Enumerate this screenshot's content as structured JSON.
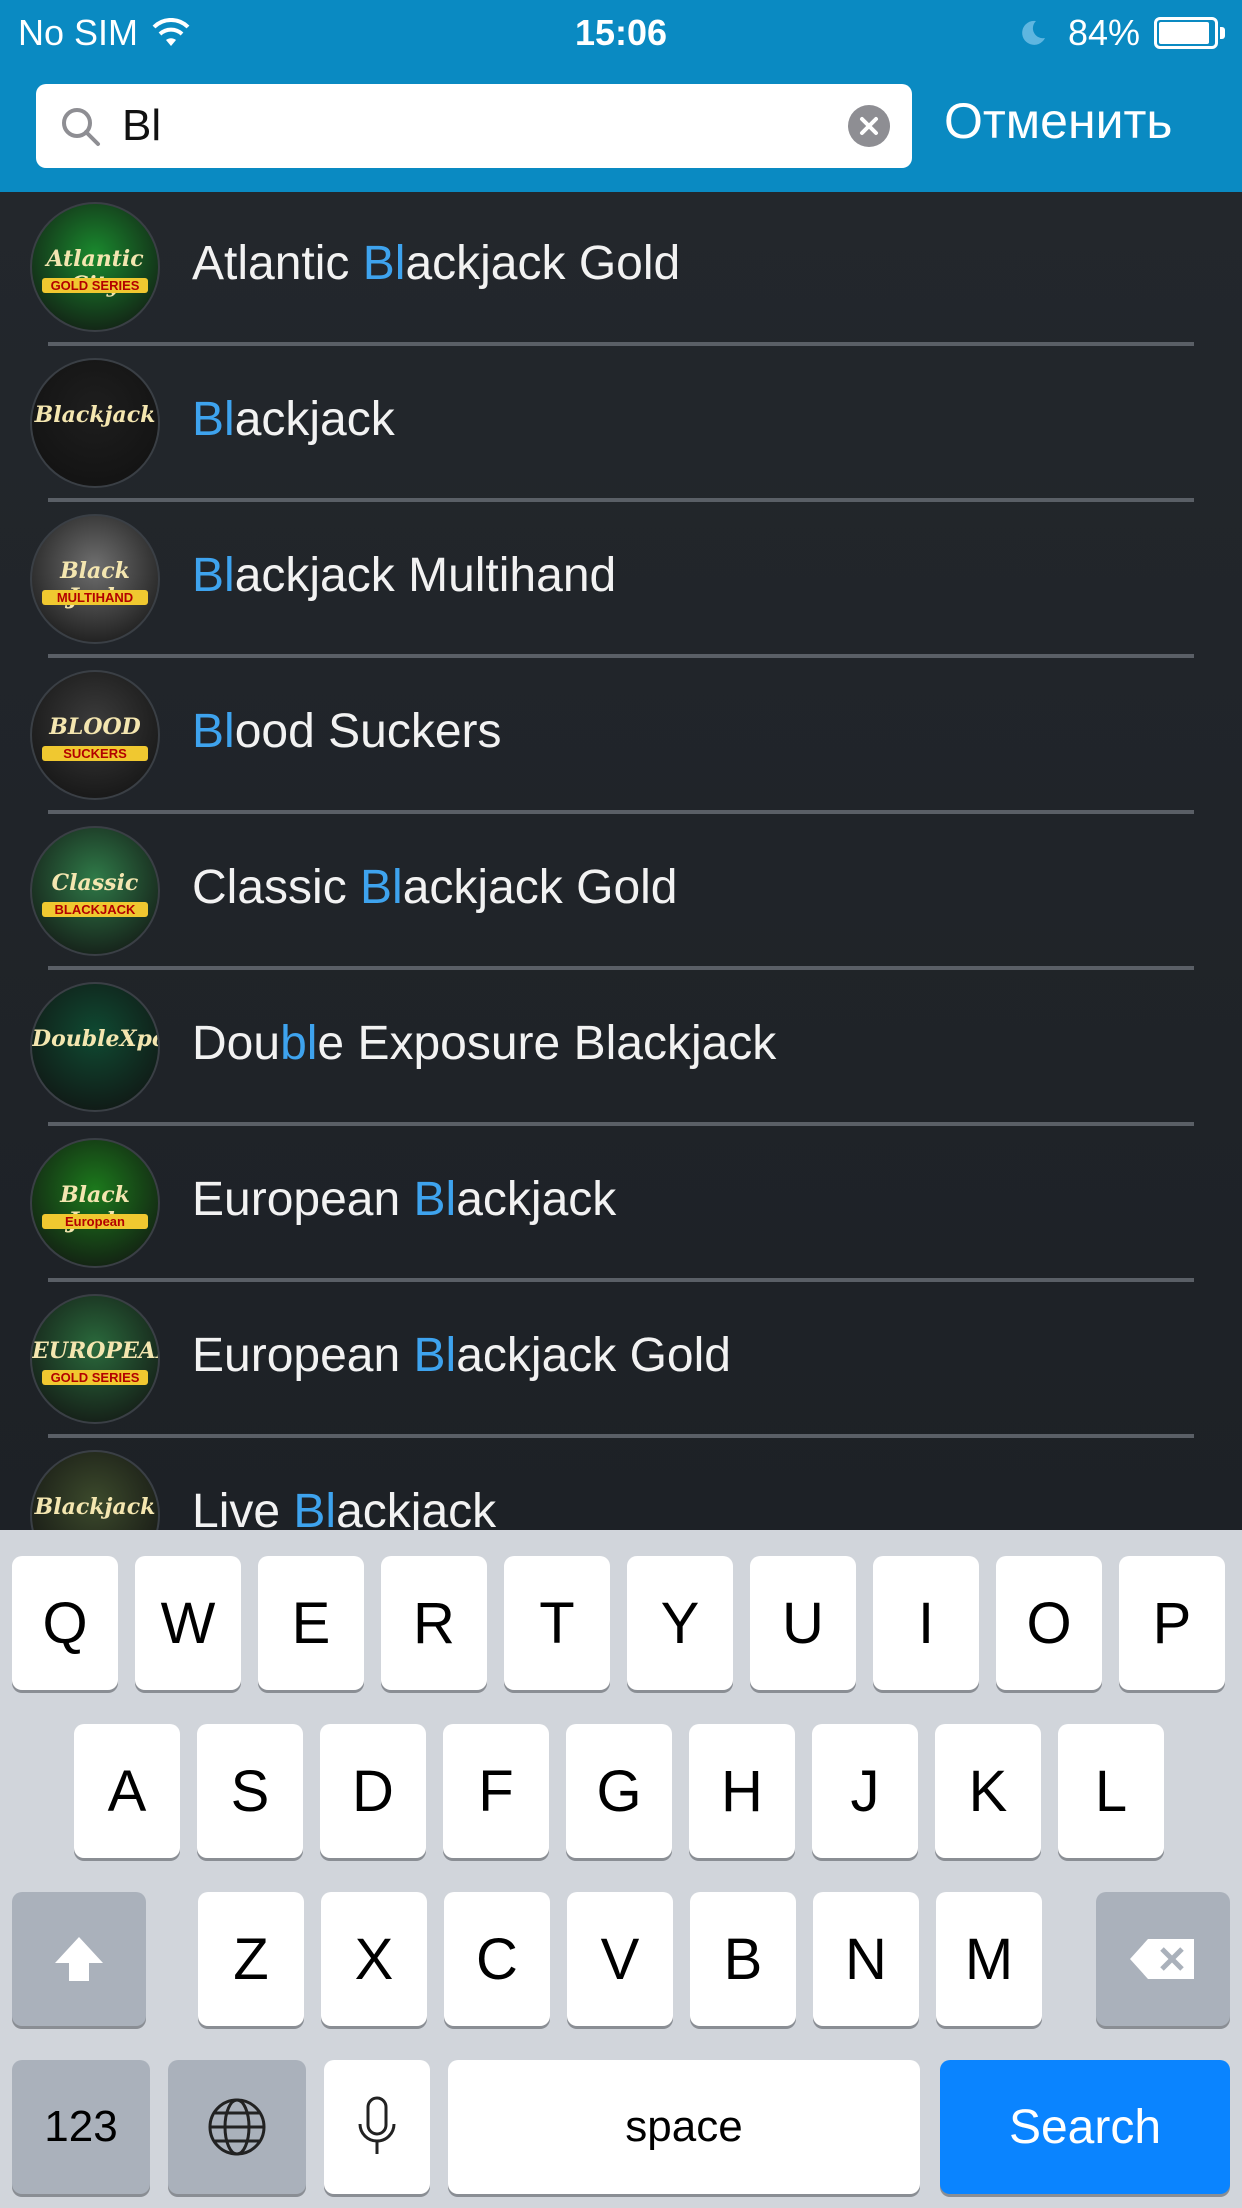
{
  "status_bar": {
    "carrier": "No SIM",
    "time": "15:06",
    "battery": "84%"
  },
  "search": {
    "value": "Bl",
    "cancel_label": "Отменить"
  },
  "results": [
    {
      "pre": "Atlantic ",
      "hl": "Bl",
      "post": "ackjack Gold",
      "thumb": {
        "line1": "Atlantic City",
        "line2": "GOLD SERIES",
        "bg": "#1a8a2e"
      }
    },
    {
      "pre": "",
      "hl": "Bl",
      "post": "ackjack",
      "thumb": {
        "line1": "Blackjack",
        "line2": "",
        "bg": "#1e1e1e"
      }
    },
    {
      "pre": "",
      "hl": "Bl",
      "post": "ackjack Multihand",
      "thumb": {
        "line1": "Black Jack",
        "line2": "MULTIHAND",
        "bg": "#6f6f6f"
      }
    },
    {
      "pre": "",
      "hl": "Bl",
      "post": "ood Suckers",
      "thumb": {
        "line1": "BLOOD",
        "line2": "SUCKERS",
        "bg": "#3b3b3b"
      }
    },
    {
      "pre": "Classic ",
      "hl": "Bl",
      "post": "ackjack Gold",
      "thumb": {
        "line1": "Classic",
        "line2": "BLACKJACK",
        "bg": "#2f7a48"
      }
    },
    {
      "pre": "Dou",
      "hl": "bl",
      "post": "e Exposure Blackjack",
      "thumb": {
        "line1": "DoubleXposure",
        "line2": "",
        "bg": "#0f4a32"
      }
    },
    {
      "pre": "European ",
      "hl": "Bl",
      "post": "ackjack",
      "thumb": {
        "line1": "Black Jack",
        "line2": "European",
        "bg": "#1c7a1c"
      }
    },
    {
      "pre": "European ",
      "hl": "Bl",
      "post": "ackjack Gold",
      "thumb": {
        "line1": "EUROPEAN",
        "line2": "GOLD SERIES",
        "bg": "#2a6a3c"
      }
    },
    {
      "pre": "Live ",
      "hl": "Bl",
      "post": "ackjack",
      "thumb": {
        "line1": "Blackjack",
        "line2": "",
        "bg": "#3c4a2c"
      }
    }
  ],
  "keyboard": {
    "row1": [
      "Q",
      "W",
      "E",
      "R",
      "T",
      "Y",
      "U",
      "I",
      "O",
      "P"
    ],
    "row2": [
      "A",
      "S",
      "D",
      "F",
      "G",
      "H",
      "J",
      "K",
      "L"
    ],
    "row3": [
      "Z",
      "X",
      "C",
      "V",
      "B",
      "N",
      "M"
    ],
    "numbers_label": "123",
    "space_label": "space",
    "search_label": "Search"
  },
  "colors": {
    "header": "#0a8ac2",
    "highlight": "#3ea3ee",
    "search_key": "#0a84ff"
  }
}
